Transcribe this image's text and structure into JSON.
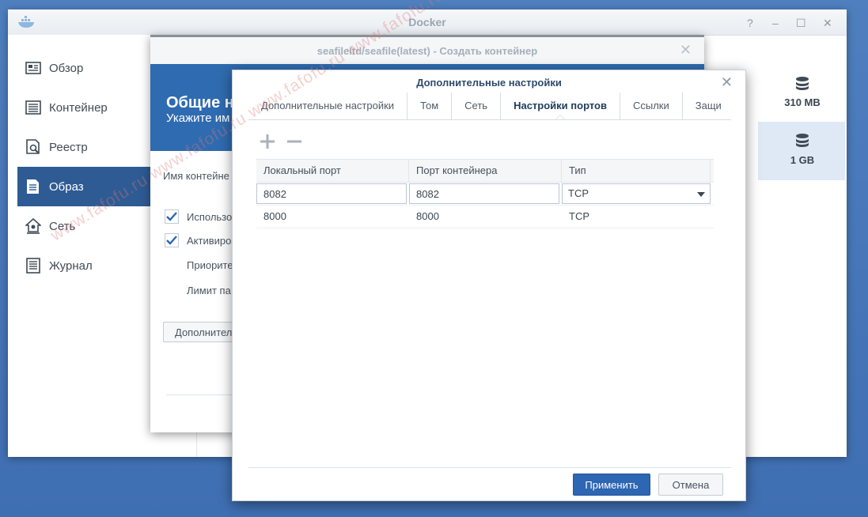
{
  "main_window": {
    "title": "Docker",
    "controls": {
      "help": "?",
      "minimize": "–",
      "maximize": "☐",
      "close": "✕"
    },
    "sidebar": [
      {
        "label": "Обзор",
        "icon": "overview-icon"
      },
      {
        "label": "Контейнер",
        "icon": "container-icon"
      },
      {
        "label": "Реестр",
        "icon": "registry-icon"
      },
      {
        "label": "Образ",
        "icon": "image-icon",
        "active": true
      },
      {
        "label": "Сеть",
        "icon": "network-icon"
      },
      {
        "label": "Журнал",
        "icon": "log-icon"
      }
    ],
    "image_sizes": [
      "310 MB",
      "1 GB"
    ]
  },
  "create_window": {
    "title": "seafileltd/seafile(latest) - Создать контейнер",
    "close": "✕",
    "header_title": "Общие н",
    "header_subtitle": "Укажите им",
    "container_name_label": "Имя контейне",
    "option1": "Использо",
    "option2": "Активиро",
    "priority_label": "Приорите",
    "limit_label": "Лимит па",
    "advanced_button": "Дополнител"
  },
  "advanced_dialog": {
    "title": "Дополнительные настройки",
    "close": "✕",
    "tabs": [
      {
        "label": "Дополнительные настройки"
      },
      {
        "label": "Том"
      },
      {
        "label": "Сеть"
      },
      {
        "label": "Настройки портов",
        "active": true
      },
      {
        "label": "Ссылки"
      },
      {
        "label": "Защи"
      }
    ],
    "toolbar": {
      "add": "+",
      "remove": "−"
    },
    "table": {
      "columns": [
        "Локальный порт",
        "Порт контейнера",
        "Тип"
      ],
      "rows": [
        {
          "local": "8082",
          "container": "8082",
          "type": "TCP",
          "editing": true
        },
        {
          "local": "8000",
          "container": "8000",
          "type": "TCP"
        }
      ]
    },
    "apply": "Применить",
    "cancel": "Отмена"
  },
  "watermark": "www.fafofu.ru www.fafofu.ru www.fafofu.ru www.fafofu.ru www.fafofu.ru"
}
